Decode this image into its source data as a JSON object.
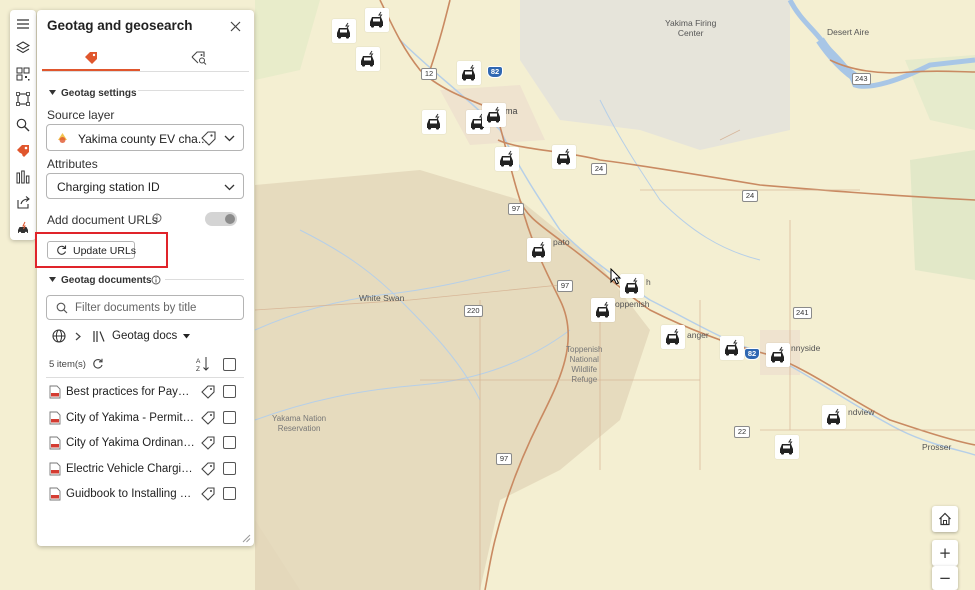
{
  "panel": {
    "title": "Geotag and geosearch",
    "tabs": [
      {
        "name": "geotag-tab",
        "active": true
      },
      {
        "name": "geosearch-tab",
        "active": false
      }
    ],
    "settings_heading": "Geotag settings",
    "source_layer_label": "Source layer",
    "source_layer_value": "Yakima county EV cha...",
    "attributes_label": "Attributes",
    "attributes_value": "Charging station ID",
    "add_urls_label": "Add document URLs",
    "add_urls_toggle_on": false,
    "update_urls_button": "Update URLs",
    "documents_heading": "Geotag documents",
    "filter_placeholder": "Filter documents by title",
    "folder_label": "Geotag docs",
    "item_count": "5 item(s)",
    "documents": [
      {
        "title": "Best practices for Payme..."
      },
      {
        "title": "City of Yakima - Permitti..."
      },
      {
        "title": "City of Yakima Ordinanc..."
      },
      {
        "title": "Electric Vehicle Charging..."
      },
      {
        "title": "Guidbook to Installing El..."
      }
    ]
  },
  "toolbar": {
    "icons": [
      "menu-icon",
      "layers-icon",
      "qr-code-icon",
      "select-rectangle-icon",
      "search-icon",
      "geotag-icon",
      "chart-icon",
      "share-icon",
      "ev-charger-icon"
    ]
  },
  "map": {
    "places": {
      "yakima": "ima",
      "firing_center": "Yakima Firing\nCenter",
      "desert_aire": "Desert Aire",
      "white_swan": "White Swan",
      "toppenish": "oppenish",
      "wapato": "pato",
      "zillah": "h",
      "granger": "anger",
      "sunnyside": "nnyside",
      "grandview": "ndview",
      "prosser": "Prosser",
      "refuge": "Toppenish\nNational\nWildlife\nRefuge",
      "reservation": "Yakama Nation\nReservation"
    },
    "shields": {
      "r12": "12",
      "i82a": "82",
      "r24a": "24",
      "r24b": "24",
      "r97a": "97",
      "r97b": "97",
      "r97c": "97",
      "r220": "220",
      "r241": "241",
      "r243": "243",
      "i82b": "82",
      "r22": "22"
    }
  },
  "map_controls": {
    "zoom_in": "+",
    "zoom_out": "−"
  },
  "colors": {
    "accent": "#e0562d",
    "highlight": "#e0242a",
    "road": "#c98a62",
    "land": "#f3eed0"
  }
}
